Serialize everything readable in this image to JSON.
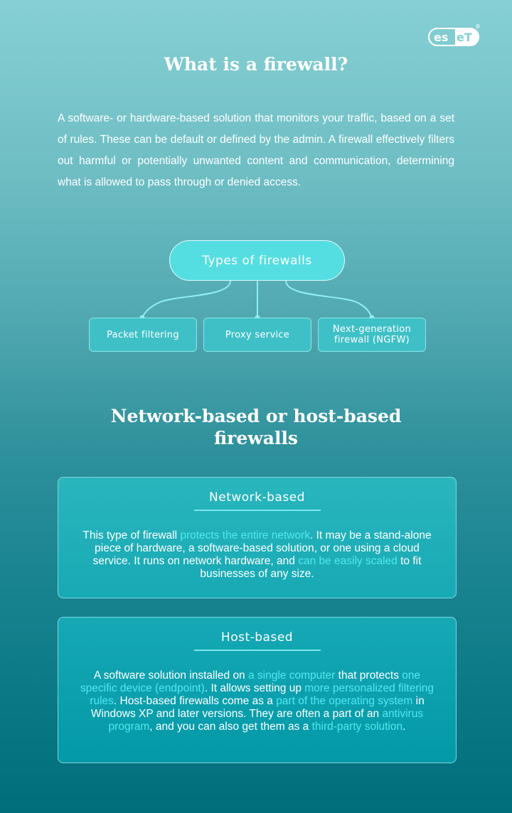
{
  "brand": {
    "logo_text": "eset",
    "registered_mark": "®"
  },
  "title": "What is a firewall?",
  "intro": "A software- or hardware-based solution that monitors your traffic, based on a set of rules. These can be default or defined by the admin. A firewall effectively filters out harmful or potentially unwanted content and communication, determining what is allowed to pass through or denied access.",
  "types": {
    "heading": "Types of firewalls",
    "items": [
      {
        "label": "Packet filtering"
      },
      {
        "label": "Proxy service"
      },
      {
        "label_line1": "Next-generation",
        "label_line2": "firewall (NGFW)"
      }
    ]
  },
  "subtitle_line1": "Network-based or host-based",
  "subtitle_line2": "firewalls",
  "colors": {
    "highlight": "#4fe9ef",
    "pill": "#55dee2",
    "bg_top": "#86d0d4",
    "bg_bottom": "#006e7b"
  },
  "network": {
    "title": "Network-based",
    "segments": [
      {
        "t": "This type of firewall ",
        "h": false
      },
      {
        "t": "protects the entire network",
        "h": true
      },
      {
        "t": ". It may be a stand-alone piece of hardware, a software-based solution, or one using a cloud service. It runs on network hardware, and ",
        "h": false
      },
      {
        "t": "can be easily scaled",
        "h": true
      },
      {
        "t": " to fit businesses of any size.",
        "h": false
      }
    ]
  },
  "host": {
    "title": "Host-based",
    "segments": [
      {
        "t": "A software solution installed on ",
        "h": false
      },
      {
        "t": "a single computer",
        "h": true
      },
      {
        "t": " that protects ",
        "h": false
      },
      {
        "t": "one specific device (endpoint)",
        "h": true
      },
      {
        "t": ". It allows setting up ",
        "h": false
      },
      {
        "t": "more personalized filtering rules",
        "h": true
      },
      {
        "t": ". Host-based firewalls come as a ",
        "h": false
      },
      {
        "t": "part of the operating system",
        "h": true
      },
      {
        "t": " in Windows XP and later versions. They are often a part of an ",
        "h": false
      },
      {
        "t": "antivirus program",
        "h": true
      },
      {
        "t": ", and you can also get them as a  ",
        "h": false
      },
      {
        "t": "third-party solution",
        "h": true
      },
      {
        "t": ".",
        "h": false
      }
    ]
  }
}
